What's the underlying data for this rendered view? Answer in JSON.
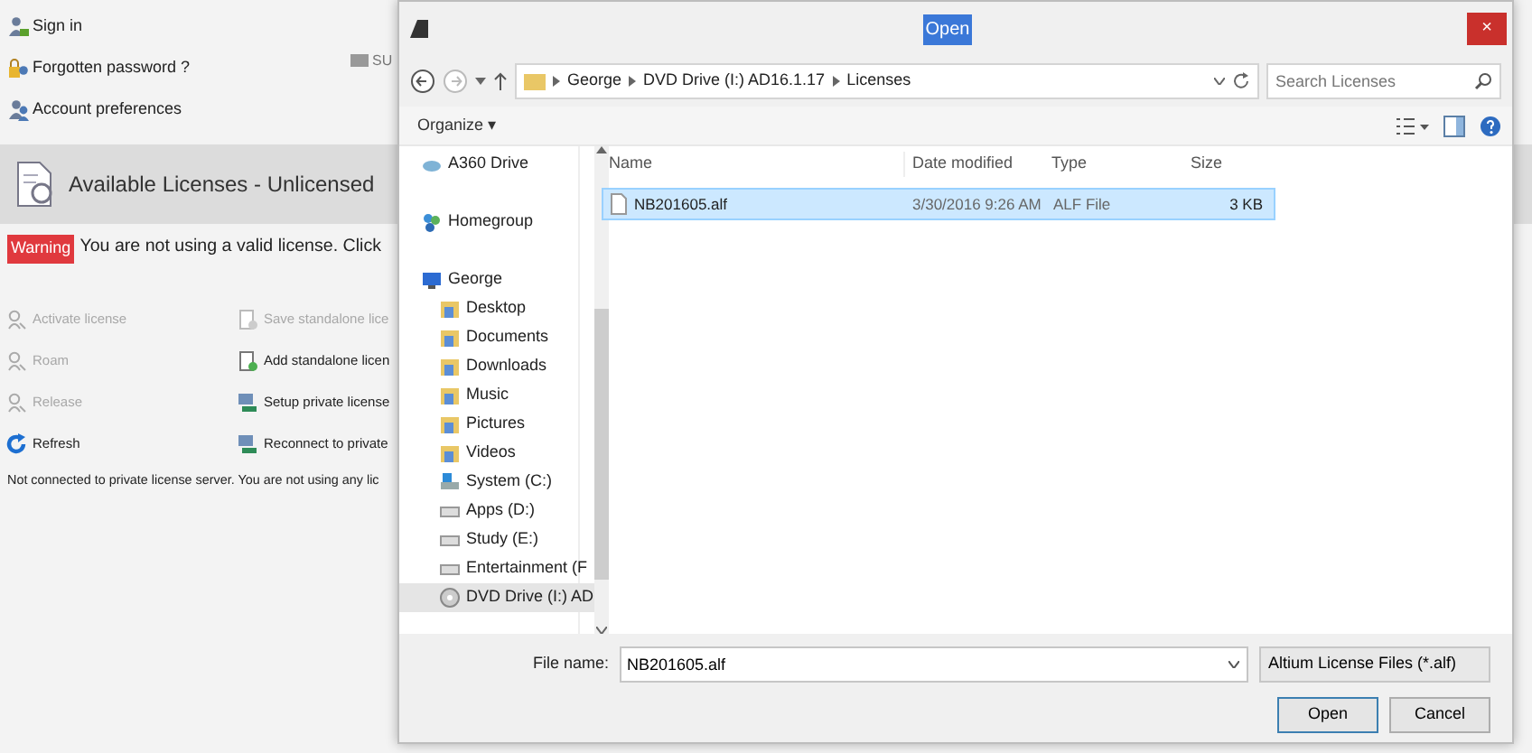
{
  "app": {
    "account_links": [
      {
        "kind": "sign-in",
        "label": "Sign in"
      },
      {
        "kind": "password",
        "label": "Forgotten password ?"
      },
      {
        "kind": "preferences",
        "label": "Account preferences"
      }
    ],
    "side_label": "SU",
    "header": {
      "title": "Available Licenses - Unlicensed"
    },
    "warning": {
      "badge": "Warning",
      "text": "You are not using a valid license. Click"
    },
    "actions": [
      {
        "kind": "key",
        "label": "Activate license",
        "disabled": true
      },
      {
        "kind": "doc",
        "label": "Save standalone lice",
        "disabled": true
      },
      {
        "kind": "key",
        "label": "Roam",
        "disabled": true
      },
      {
        "kind": "doc",
        "label": "Add standalone licen",
        "disabled": false
      },
      {
        "kind": "key",
        "label": "Release",
        "disabled": true
      },
      {
        "kind": "server",
        "label": "Setup private license",
        "disabled": false
      },
      {
        "kind": "refresh",
        "label": "Refresh",
        "disabled": false
      },
      {
        "kind": "server",
        "label": "Reconnect to private",
        "disabled": false
      }
    ],
    "status": "Not connected to private license server. You are not using any lic"
  },
  "dialog": {
    "title": "Open",
    "close": "×",
    "breadcrumbs": [
      "George",
      "DVD Drive (I:) AD16.1.17",
      "Licenses"
    ],
    "search": {
      "placeholder": "Search Licenses"
    },
    "toolbar": {
      "organize": "Organize ▾"
    },
    "nav": [
      {
        "kind": "cloud",
        "label": "A360 Drive",
        "selected": false
      },
      {
        "kind": "homegroup",
        "label": "Homegroup",
        "selected": false
      },
      {
        "kind": "user",
        "label": "George",
        "selected": false,
        "children": [
          {
            "kind": "folder",
            "label": "Desktop",
            "selected": false
          },
          {
            "kind": "folder",
            "label": "Documents",
            "selected": false
          },
          {
            "kind": "folder",
            "label": "Downloads",
            "selected": false
          },
          {
            "kind": "folder",
            "label": "Music",
            "selected": false
          },
          {
            "kind": "folder",
            "label": "Pictures",
            "selected": false
          },
          {
            "kind": "folder",
            "label": "Videos",
            "selected": false
          },
          {
            "kind": "system",
            "label": "System (C:)",
            "selected": false
          },
          {
            "kind": "drive",
            "label": "Apps (D:)",
            "selected": false
          },
          {
            "kind": "drive",
            "label": "Study (E:)",
            "selected": false
          },
          {
            "kind": "drive",
            "label": "Entertainment (F",
            "selected": false
          },
          {
            "kind": "dvd",
            "label": "DVD Drive (I:) AD",
            "selected": true
          }
        ]
      }
    ],
    "columns": [
      "Name",
      "Date modified",
      "Type",
      "Size"
    ],
    "files": [
      {
        "name": "NB201605.alf",
        "date": "3/30/2016 9:26 AM",
        "type": "ALF File",
        "size": "3 KB",
        "selected": true
      }
    ],
    "file_name": {
      "label": "File name:",
      "value": "NB201605.alf"
    },
    "file_type": "Altium License Files (*.alf)",
    "buttons": [
      "Open",
      "Cancel"
    ]
  }
}
